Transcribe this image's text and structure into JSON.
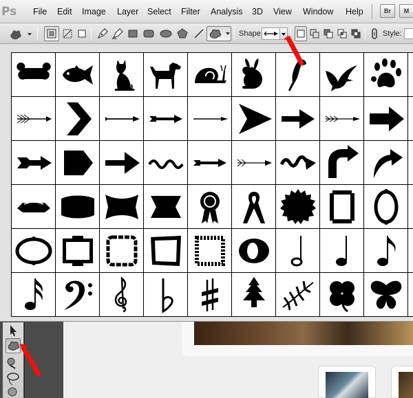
{
  "app": {
    "logo": "Ps"
  },
  "menu": [
    "File",
    "Edit",
    "Image",
    "Layer",
    "Select",
    "Filter",
    "Analysis",
    "3D",
    "View",
    "Window",
    "Help"
  ],
  "app_buttons": [
    "Br",
    "M"
  ],
  "options": {
    "shape_label": "Shape:",
    "style_label": "Style:"
  },
  "shapes": [
    [
      "bone-shape",
      "fish-shape",
      "cat-shape",
      "dog-shape",
      "snail-shape",
      "rabbit-shape",
      "parrot-shape",
      "bird-shape",
      "paw-print-shape",
      "blank-shape"
    ],
    [
      "arrow-feathered-shape",
      "chevron-shape",
      "arrow-thin-shape",
      "arrow-medium-shape",
      "arrow-line-shape",
      "arrowhead-triangle-shape",
      "arrow-bold-shape",
      "arrow-fletched-shape",
      "arrow-block-shape",
      "blank-shape"
    ],
    [
      "arrow-feathered-bold-shape",
      "arrow-pentagon-shape",
      "arrow-wide-shape",
      "wave-shape",
      "arrow-notched-shape",
      "arrow-double-feather-shape",
      "arrow-squiggle-shape",
      "u-turn-arrow-shape",
      "curved-arrow-shape",
      "blank-shape"
    ],
    [
      "banner-ribbon-shape",
      "banner-wave-shape",
      "banner-bow-shape",
      "banner-concave-shape",
      "award-ribbon-shape",
      "awareness-ribbon-shape",
      "starburst-seal-shape",
      "ornate-frame-shape",
      "oval-frame-shape",
      "blank-shape"
    ],
    [
      "oval-ornate-frame-shape",
      "rectangle-ornate-frame-shape",
      "scalloped-frame-shape",
      "rough-frame-shape",
      "zigzag-frame-shape",
      "o-ring-shape",
      "half-note-shape",
      "quarter-note-shape",
      "eighth-note-shape",
      "blank-shape"
    ],
    [
      "sixteenth-note-shape",
      "bass-clef-shape",
      "treble-clef-shape",
      "flat-sign-shape",
      "sharp-sign-shape",
      "tree-shape",
      "fern-leaf-shape",
      "clover-shape",
      "butterfly-shape",
      "blank-shape"
    ]
  ],
  "toolbar_icons": [
    "custom-shape-tool-icon",
    "shape-layers-icon",
    "paths-icon",
    "fill-pixels-icon",
    "pen-icon",
    "freeform-pen-icon",
    "rectangle-icon",
    "rounded-rectangle-icon",
    "ellipse-icon",
    "polygon-icon",
    "line-icon",
    "custom-shape-icon"
  ],
  "accent_color": "#e8130f"
}
